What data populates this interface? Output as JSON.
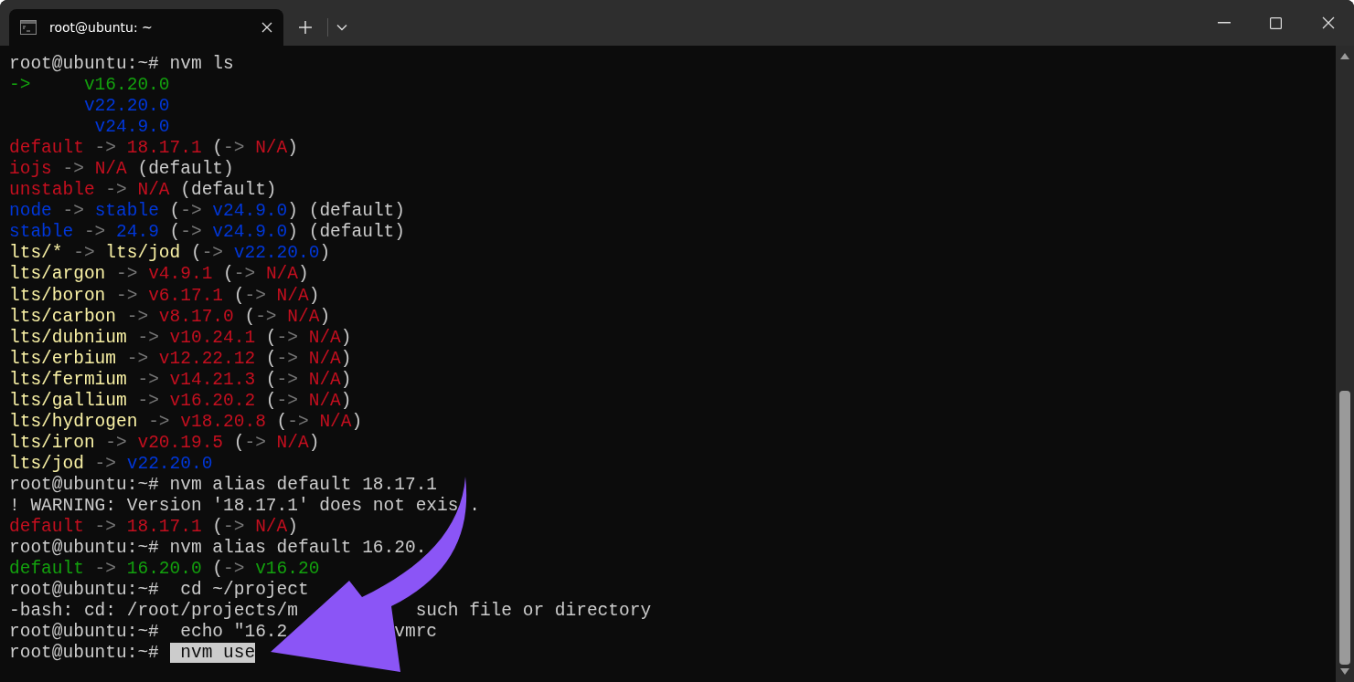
{
  "tabs": [
    {
      "title": "root@ubuntu: ~",
      "selected": true
    }
  ],
  "lines": [
    [
      {
        "text": "root@ubuntu:~# nvm ls",
        "kind": "white"
      }
    ],
    [
      {
        "text": "->     v16.20.0",
        "kind": "green"
      }
    ],
    [
      {
        "text": "       v22.20.0",
        "kind": "blue"
      }
    ],
    [
      {
        "text": "        v24.9.0",
        "kind": "blue"
      }
    ],
    [
      {
        "text": "default",
        "kind": "red"
      },
      {
        "text": " -> ",
        "kind": "gray"
      },
      {
        "text": "18.17.1",
        "kind": "red"
      },
      {
        "text": " (",
        "kind": "white"
      },
      {
        "text": "-> ",
        "kind": "gray"
      },
      {
        "text": "N/A",
        "kind": "red"
      },
      {
        "text": ")",
        "kind": "white"
      }
    ],
    [
      {
        "text": "iojs",
        "kind": "red"
      },
      {
        "text": " -> ",
        "kind": "gray"
      },
      {
        "text": "N/A",
        "kind": "red"
      },
      {
        "text": " (default)",
        "kind": "white"
      }
    ],
    [
      {
        "text": "unstable",
        "kind": "red"
      },
      {
        "text": " -> ",
        "kind": "gray"
      },
      {
        "text": "N/A",
        "kind": "red"
      },
      {
        "text": " (default)",
        "kind": "white"
      }
    ],
    [
      {
        "text": "node",
        "kind": "blue"
      },
      {
        "text": " -> ",
        "kind": "gray"
      },
      {
        "text": "stable",
        "kind": "blue"
      },
      {
        "text": " (",
        "kind": "white"
      },
      {
        "text": "-> ",
        "kind": "gray"
      },
      {
        "text": "v24.9.0",
        "kind": "blue"
      },
      {
        "text": ") (default)",
        "kind": "white"
      }
    ],
    [
      {
        "text": "stable",
        "kind": "blue"
      },
      {
        "text": " -> ",
        "kind": "gray"
      },
      {
        "text": "24.9",
        "kind": "blue"
      },
      {
        "text": " (",
        "kind": "white"
      },
      {
        "text": "-> ",
        "kind": "gray"
      },
      {
        "text": "v24.9.0",
        "kind": "blue"
      },
      {
        "text": ") (default)",
        "kind": "white"
      }
    ],
    [
      {
        "text": "lts/*",
        "kind": "yellow"
      },
      {
        "text": " -> ",
        "kind": "gray"
      },
      {
        "text": "lts/jod",
        "kind": "yellow"
      },
      {
        "text": " (",
        "kind": "white"
      },
      {
        "text": "-> ",
        "kind": "gray"
      },
      {
        "text": "v22.20.0",
        "kind": "blue"
      },
      {
        "text": ")",
        "kind": "white"
      }
    ],
    [
      {
        "text": "lts/argon",
        "kind": "yellow"
      },
      {
        "text": " -> ",
        "kind": "gray"
      },
      {
        "text": "v4.9.1",
        "kind": "red"
      },
      {
        "text": " (",
        "kind": "white"
      },
      {
        "text": "-> ",
        "kind": "gray"
      },
      {
        "text": "N/A",
        "kind": "red"
      },
      {
        "text": ")",
        "kind": "white"
      }
    ],
    [
      {
        "text": "lts/boron",
        "kind": "yellow"
      },
      {
        "text": " -> ",
        "kind": "gray"
      },
      {
        "text": "v6.17.1",
        "kind": "red"
      },
      {
        "text": " (",
        "kind": "white"
      },
      {
        "text": "-> ",
        "kind": "gray"
      },
      {
        "text": "N/A",
        "kind": "red"
      },
      {
        "text": ")",
        "kind": "white"
      }
    ],
    [
      {
        "text": "lts/carbon",
        "kind": "yellow"
      },
      {
        "text": " -> ",
        "kind": "gray"
      },
      {
        "text": "v8.17.0",
        "kind": "red"
      },
      {
        "text": " (",
        "kind": "white"
      },
      {
        "text": "-> ",
        "kind": "gray"
      },
      {
        "text": "N/A",
        "kind": "red"
      },
      {
        "text": ")",
        "kind": "white"
      }
    ],
    [
      {
        "text": "lts/dubnium",
        "kind": "yellow"
      },
      {
        "text": " -> ",
        "kind": "gray"
      },
      {
        "text": "v10.24.1",
        "kind": "red"
      },
      {
        "text": " (",
        "kind": "white"
      },
      {
        "text": "-> ",
        "kind": "gray"
      },
      {
        "text": "N/A",
        "kind": "red"
      },
      {
        "text": ")",
        "kind": "white"
      }
    ],
    [
      {
        "text": "lts/erbium",
        "kind": "yellow"
      },
      {
        "text": " -> ",
        "kind": "gray"
      },
      {
        "text": "v12.22.12",
        "kind": "red"
      },
      {
        "text": " (",
        "kind": "white"
      },
      {
        "text": "-> ",
        "kind": "gray"
      },
      {
        "text": "N/A",
        "kind": "red"
      },
      {
        "text": ")",
        "kind": "white"
      }
    ],
    [
      {
        "text": "lts/fermium",
        "kind": "yellow"
      },
      {
        "text": " -> ",
        "kind": "gray"
      },
      {
        "text": "v14.21.3",
        "kind": "red"
      },
      {
        "text": " (",
        "kind": "white"
      },
      {
        "text": "-> ",
        "kind": "gray"
      },
      {
        "text": "N/A",
        "kind": "red"
      },
      {
        "text": ")",
        "kind": "white"
      }
    ],
    [
      {
        "text": "lts/gallium",
        "kind": "yellow"
      },
      {
        "text": " -> ",
        "kind": "gray"
      },
      {
        "text": "v16.20.2",
        "kind": "red"
      },
      {
        "text": " (",
        "kind": "white"
      },
      {
        "text": "-> ",
        "kind": "gray"
      },
      {
        "text": "N/A",
        "kind": "red"
      },
      {
        "text": ")",
        "kind": "white"
      }
    ],
    [
      {
        "text": "lts/hydrogen",
        "kind": "yellow"
      },
      {
        "text": " -> ",
        "kind": "gray"
      },
      {
        "text": "v18.20.8",
        "kind": "red"
      },
      {
        "text": " (",
        "kind": "white"
      },
      {
        "text": "-> ",
        "kind": "gray"
      },
      {
        "text": "N/A",
        "kind": "red"
      },
      {
        "text": ")",
        "kind": "white"
      }
    ],
    [
      {
        "text": "lts/iron",
        "kind": "yellow"
      },
      {
        "text": " -> ",
        "kind": "gray"
      },
      {
        "text": "v20.19.5",
        "kind": "red"
      },
      {
        "text": " (",
        "kind": "white"
      },
      {
        "text": "-> ",
        "kind": "gray"
      },
      {
        "text": "N/A",
        "kind": "red"
      },
      {
        "text": ")",
        "kind": "white"
      }
    ],
    [
      {
        "text": "lts/jod",
        "kind": "yellow"
      },
      {
        "text": " -> ",
        "kind": "gray"
      },
      {
        "text": "v22.20.0",
        "kind": "blue"
      }
    ],
    [
      {
        "text": "root@ubuntu:~# nvm alias default 18.17.1",
        "kind": "white"
      }
    ],
    [
      {
        "text": "! WARNING: Version '18.17.1' does not exis .",
        "kind": "white"
      }
    ],
    [
      {
        "text": "default",
        "kind": "red"
      },
      {
        "text": " -> ",
        "kind": "gray"
      },
      {
        "text": "18.17.1",
        "kind": "red"
      },
      {
        "text": " (",
        "kind": "white"
      },
      {
        "text": "-> ",
        "kind": "gray"
      },
      {
        "text": "N/A",
        "kind": "red"
      },
      {
        "text": ")",
        "kind": "white"
      }
    ],
    [
      {
        "text": "root@ubuntu:~# nvm alias default 16.20.",
        "kind": "white"
      }
    ],
    [
      {
        "text": "default",
        "kind": "green"
      },
      {
        "text": " -> ",
        "kind": "gray"
      },
      {
        "text": "16.20.0",
        "kind": "green"
      },
      {
        "text": " (",
        "kind": "white"
      },
      {
        "text": "-> ",
        "kind": "gray"
      },
      {
        "text": "v16.20",
        "kind": "green"
      }
    ],
    [
      {
        "text": "root@ubuntu:~#  cd ~/project",
        "kind": "white"
      }
    ],
    [
      {
        "text": "-bash: cd: /root/projects/m           such file or directory",
        "kind": "white"
      }
    ],
    [
      {
        "text": "root@ubuntu:~#  echo \"16.2          vmrc",
        "kind": "white"
      }
    ],
    [
      {
        "text": "root@ubuntu:~# ",
        "kind": "white"
      },
      {
        "text": " nvm use",
        "kind": "selection"
      }
    ]
  ]
}
